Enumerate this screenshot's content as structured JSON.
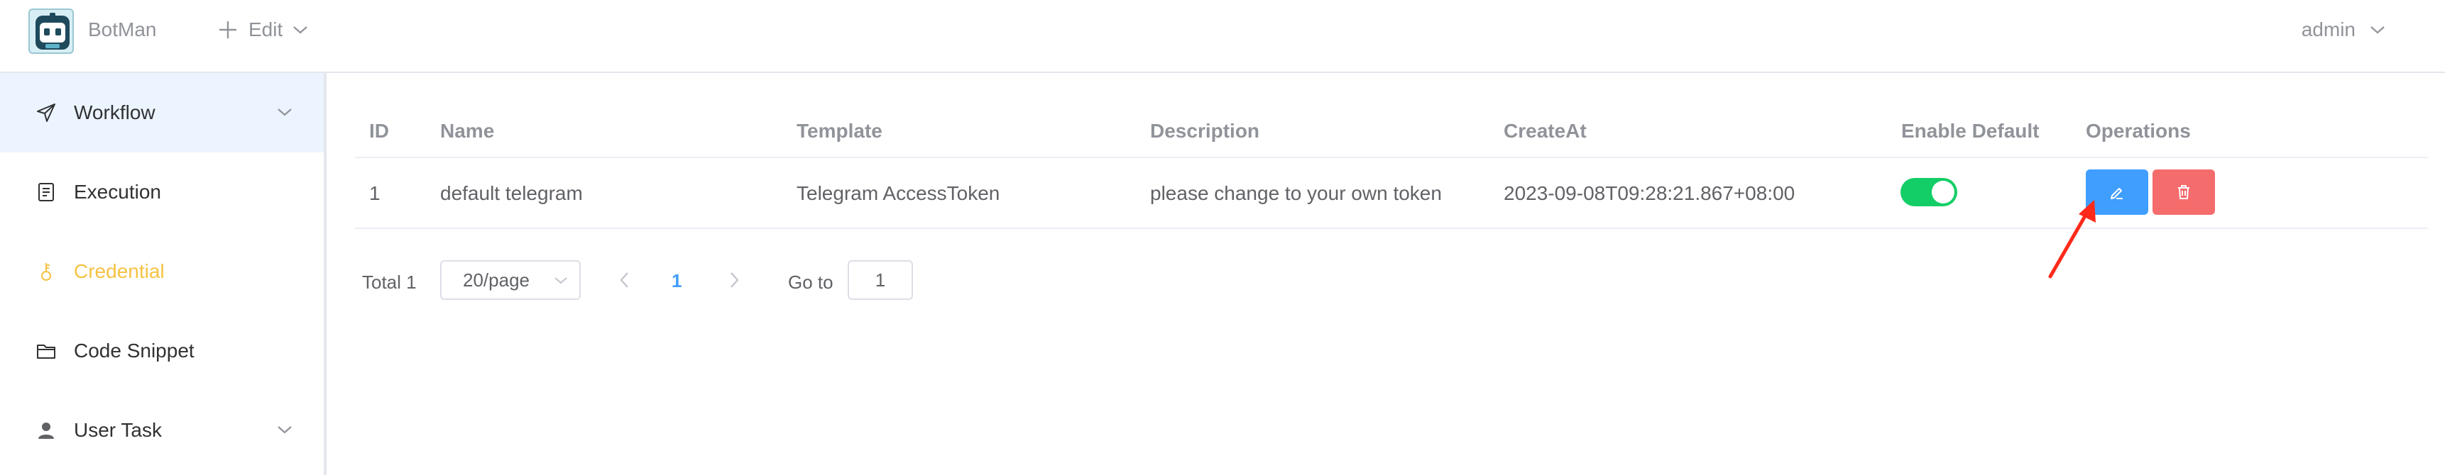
{
  "header": {
    "app_name": "BotMan",
    "edit_label": "Edit",
    "user_label": "admin"
  },
  "sidebar": {
    "items": [
      {
        "label": "Workflow",
        "icon": "paper-plane-icon",
        "expandable": true
      },
      {
        "label": "Execution",
        "icon": "document-icon",
        "expandable": false
      },
      {
        "label": "Credential",
        "icon": "key-icon",
        "expandable": false,
        "active": true
      },
      {
        "label": "Code Snippet",
        "icon": "folder-icon",
        "expandable": false
      },
      {
        "label": "User Task",
        "icon": "user-icon",
        "expandable": true
      }
    ]
  },
  "table": {
    "columns": [
      "ID",
      "Name",
      "Template",
      "Description",
      "CreateAt",
      "Enable Default",
      "Operations"
    ],
    "rows": [
      {
        "id": "1",
        "name": "default telegram",
        "template": "Telegram AccessToken",
        "description": "please change to your own token",
        "create_at": "2023-09-08T09:28:21.867+08:00",
        "enable_default": true
      }
    ]
  },
  "pagination": {
    "total_label": "Total 1",
    "page_size": "20/page",
    "current_page": "1",
    "goto_label": "Go to",
    "goto_value": "1"
  },
  "colors": {
    "primary": "#409eff",
    "danger": "#f56c6c",
    "success": "#13ce66",
    "active_menu": "#f5c242",
    "annotation_arrow": "#ff2a1a"
  }
}
